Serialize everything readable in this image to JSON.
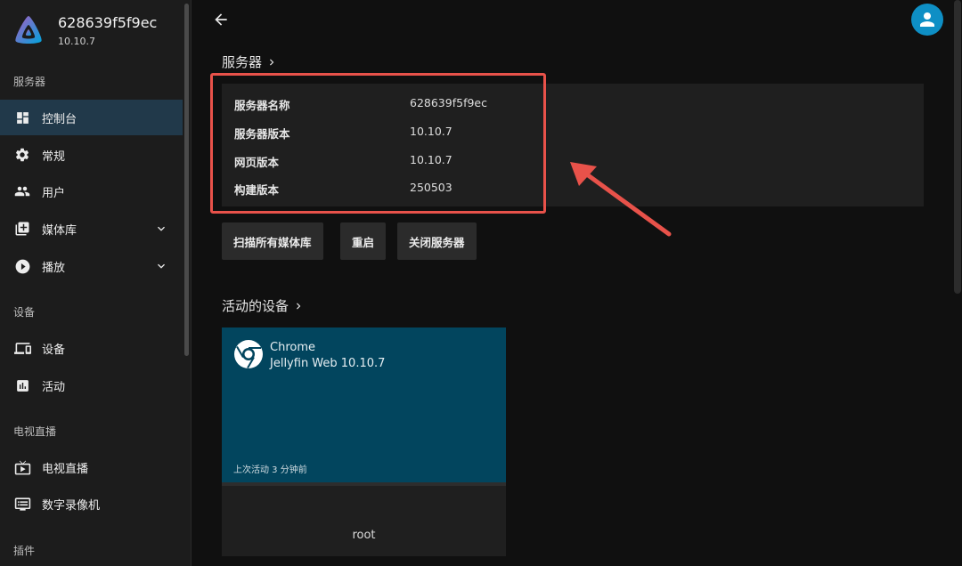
{
  "brand": {
    "title": "628639f5f9ec",
    "version": "10.10.7"
  },
  "sidebar": {
    "sections": {
      "server": "服务器",
      "devices": "设备",
      "livetv": "电视直播",
      "plugins": "插件"
    },
    "items": [
      {
        "label": "控制台",
        "icon": "dashboard-icon"
      },
      {
        "label": "常规",
        "icon": "gear-icon"
      },
      {
        "label": "用户",
        "icon": "people-icon"
      },
      {
        "label": "媒体库",
        "icon": "library-add-icon"
      },
      {
        "label": "播放",
        "icon": "play-circle-icon"
      },
      {
        "label": "设备",
        "icon": "devices-icon"
      },
      {
        "label": "活动",
        "icon": "activity-chart-icon"
      },
      {
        "label": "电视直播",
        "icon": "live-tv-icon"
      },
      {
        "label": "数字录像机",
        "icon": "dvr-icon"
      }
    ]
  },
  "server_section": {
    "heading": "服务器",
    "info": [
      {
        "key": "服务器名称",
        "value": "628639f5f9ec"
      },
      {
        "key": "服务器版本",
        "value": "10.10.7"
      },
      {
        "key": "网页版本",
        "value": "10.10.7"
      },
      {
        "key": "构建版本",
        "value": "250503"
      }
    ],
    "buttons": {
      "scan": "扫描所有媒体库",
      "restart": "重启",
      "shutdown": "关闭服务器"
    }
  },
  "devices_section": {
    "heading": "活动的设备",
    "device": {
      "app": "Chrome",
      "client": "Jellyfin Web 10.10.7",
      "last_active": "上次活动 3 分钟前",
      "user": "root"
    }
  },
  "colors": {
    "accent": "#00a4dc",
    "active_nav": "#21394a",
    "device_card": "#02455e",
    "annotation": "#e8524a"
  }
}
